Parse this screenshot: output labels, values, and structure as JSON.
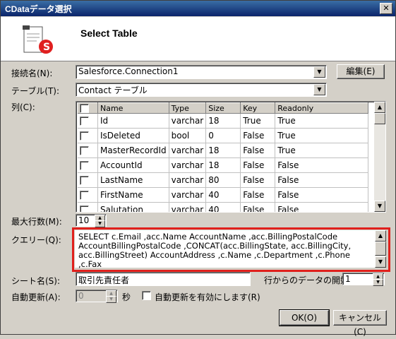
{
  "window": {
    "title": "CDataデータ選択",
    "close_glyph": "✕"
  },
  "header": {
    "title": "Select Table"
  },
  "connection": {
    "label": "接続名(N):",
    "value": "Salesforce.Connection1",
    "edit_button": "編集(E)"
  },
  "table": {
    "label": "テーブル(T):",
    "value": "Contact テーブル"
  },
  "columns": {
    "label": "列(C):",
    "headers": [
      "Name",
      "Type",
      "Size",
      "Key",
      "Readonly"
    ],
    "rows": [
      {
        "name": "Id",
        "type": "varchar",
        "size": "18",
        "key": "True",
        "readonly": "True"
      },
      {
        "name": "IsDeleted",
        "type": "bool",
        "size": "0",
        "key": "False",
        "readonly": "True"
      },
      {
        "name": "MasterRecordId",
        "type": "varchar",
        "size": "18",
        "key": "False",
        "readonly": "True"
      },
      {
        "name": "AccountId",
        "type": "varchar",
        "size": "18",
        "key": "False",
        "readonly": "False"
      },
      {
        "name": "LastName",
        "type": "varchar",
        "size": "80",
        "key": "False",
        "readonly": "False"
      },
      {
        "name": "FirstName",
        "type": "varchar",
        "size": "40",
        "key": "False",
        "readonly": "False"
      },
      {
        "name": "Salutation",
        "type": "varchar",
        "size": "40",
        "key": "False",
        "readonly": "False"
      }
    ]
  },
  "max_rows": {
    "label": "最大行数(M):",
    "value": "10"
  },
  "query": {
    "label": "クエリー(Q):",
    "lines": [
      "SELECT c.Email ,acc.Name AccountName ,acc.BillingPostalCode",
      "AccountBillingPostalCode ,CONCAT(acc.BillingState, acc.BillingCity,",
      "acc.BillingStreet) AccountAddress ,c.Name ,c.Department ,c.Phone ,c.Fax"
    ]
  },
  "sheet": {
    "label": "シート名(S):",
    "value": "取引先責任者",
    "start_row_label": "行からのデータの開始",
    "start_row_value": "1"
  },
  "auto_refresh": {
    "label": "自動更新(A):",
    "value": "0",
    "unit": "秒",
    "checkbox_label": "自動更新を有効にします(R)"
  },
  "buttons": {
    "ok": "OK(O)",
    "cancel": "キャンセル(C)"
  }
}
